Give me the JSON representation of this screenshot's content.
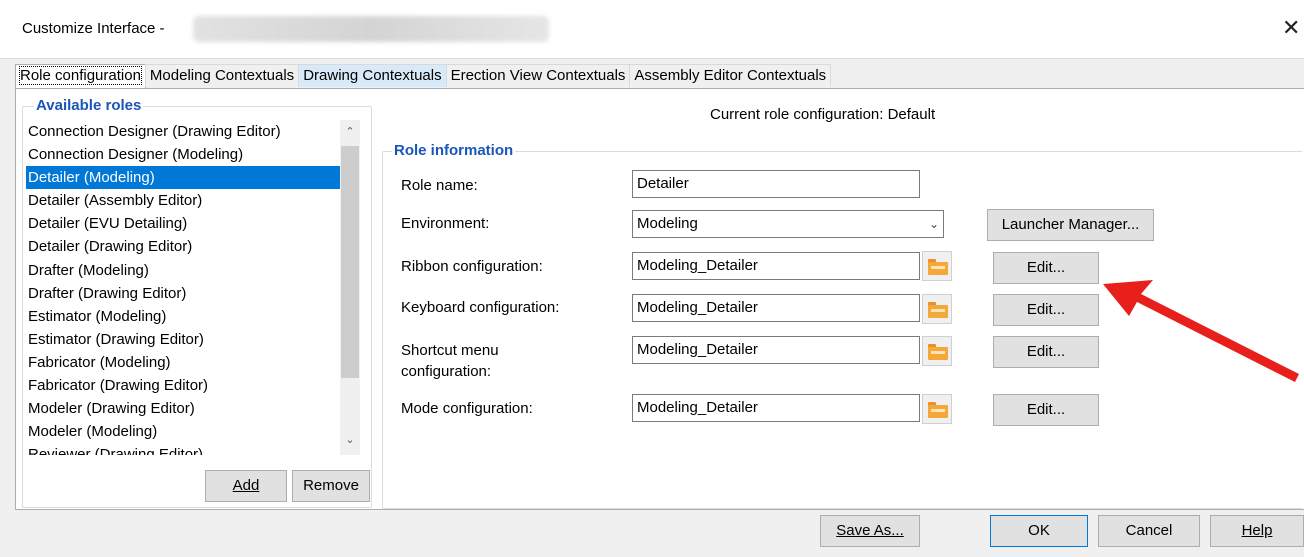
{
  "window": {
    "title": "Customize Interface -",
    "close_glyph": "✕"
  },
  "tabs": [
    {
      "label": "Role configuration"
    },
    {
      "label": "Modeling Contextuals"
    },
    {
      "label": "Drawing Contextuals"
    },
    {
      "label": "Erection View Contextuals"
    },
    {
      "label": "Assembly Editor Contextuals"
    }
  ],
  "available_roles": {
    "legend": "Available roles",
    "items": [
      "Connection Designer (Drawing Editor)",
      "Connection Designer (Modeling)",
      "Detailer (Modeling)",
      "Detailer (Assembly Editor)",
      "Detailer (EVU Detailing)",
      "Detailer (Drawing Editor)",
      "Drafter (Modeling)",
      "Drafter (Drawing Editor)",
      "Estimator (Modeling)",
      "Estimator (Drawing Editor)",
      "Fabricator (Modeling)",
      "Fabricator (Drawing Editor)",
      "Modeler (Drawing Editor)",
      "Modeler (Modeling)",
      "Reviewer (Drawing Editor)"
    ],
    "selected_index": 2,
    "add_label": "Add",
    "remove_label": "Remove"
  },
  "current_role": "Current role configuration:  Default",
  "role_info": {
    "legend": "Role information",
    "role_name_label": "Role name:",
    "role_name_value": "Detailer",
    "environment_label": "Environment:",
    "environment_value": "Modeling",
    "launcher_label": "Launcher Manager...",
    "ribbon_label": "Ribbon configuration:",
    "ribbon_value": "Modeling_Detailer",
    "keyboard_label": "Keyboard configuration:",
    "keyboard_value": "Modeling_Detailer",
    "shortcut_label_1": "Shortcut menu",
    "shortcut_label_2": "configuration:",
    "shortcut_value": "Modeling_Detailer",
    "mode_label": "Mode configuration:",
    "mode_value": "Modeling_Detailer",
    "edit_label": "Edit..."
  },
  "footer": {
    "save_as": "Save As...",
    "ok": "OK",
    "cancel": "Cancel",
    "help": "Help"
  },
  "colors": {
    "selection": "#0078d7",
    "legend": "#1a56b8",
    "arrow": "#e8201c",
    "folder": "#f5a83a"
  }
}
